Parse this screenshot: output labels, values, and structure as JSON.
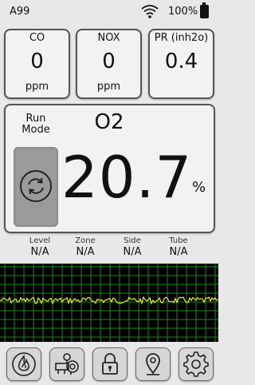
{
  "status": {
    "device_id": "A99",
    "battery": "100%",
    "wifi_icon": "wifi-icon",
    "battery_icon": "battery-icon"
  },
  "gas_cards": [
    {
      "name": "CO",
      "value": "0",
      "unit": "ppm"
    },
    {
      "name": "NOX",
      "value": "0",
      "unit": "ppm"
    },
    {
      "name": "PR (inh2o)",
      "value": "0.4",
      "unit": ""
    }
  ],
  "main": {
    "run_mode_label": "Run Mode",
    "run_icon": "refresh-icon",
    "gas": "O2",
    "value": "20.7",
    "unit": "%"
  },
  "location": {
    "level": {
      "label": "Level",
      "value": "N/A"
    },
    "zone": {
      "label": "Zone",
      "value": "N/A"
    },
    "side": {
      "label": "Side",
      "value": "N/A"
    },
    "tube": {
      "label": "Tube",
      "value": "N/A"
    }
  },
  "graph": {
    "grid_color": "#1a8a1a",
    "line_color": "#f2ee1a",
    "background": "#000000"
  },
  "toolbar": [
    "flame-icon",
    "pump-icon",
    "lock-icon",
    "location-pin-icon",
    "gear-icon"
  ]
}
